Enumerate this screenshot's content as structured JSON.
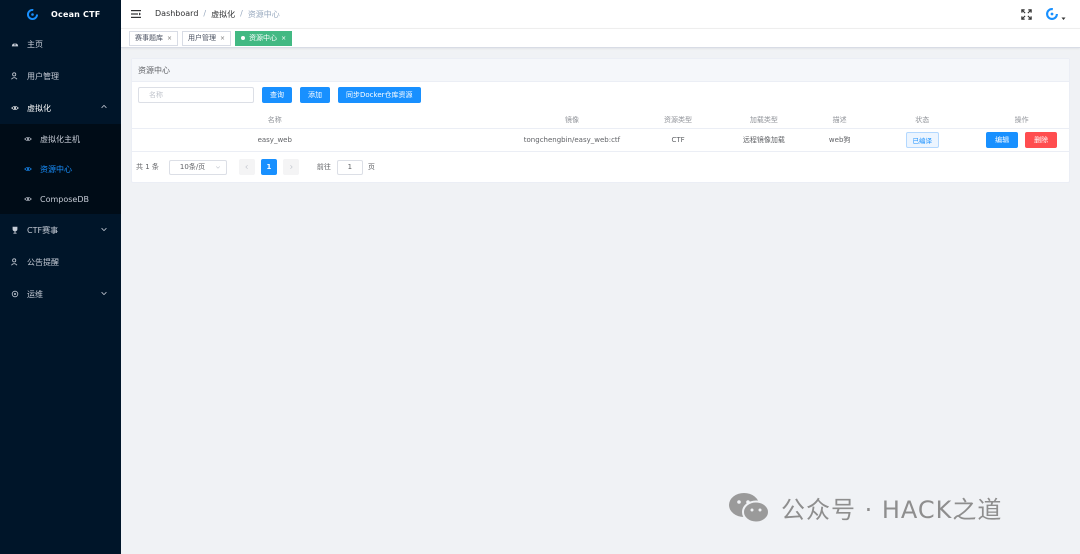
{
  "app": {
    "title": "Ocean CTF"
  },
  "sidebar": {
    "items": [
      {
        "label": "主页",
        "icon": "dashboard-icon"
      },
      {
        "label": "用户管理",
        "icon": "user-icon"
      },
      {
        "label": "虚拟化",
        "icon": "eye-icon",
        "expanded": true,
        "children": [
          {
            "label": "虚拟化主机",
            "icon": "eye-icon"
          },
          {
            "label": "资源中心",
            "icon": "eye-icon",
            "active": true
          },
          {
            "label": "ComposeDB",
            "icon": "eye-icon"
          }
        ]
      },
      {
        "label": "CTF赛事",
        "icon": "trophy-icon"
      },
      {
        "label": "公告提醒",
        "icon": "user-icon"
      },
      {
        "label": "运维",
        "icon": "settings-icon"
      }
    ]
  },
  "breadcrumb": {
    "items": [
      "Dashboard",
      "虚拟化",
      "资源中心"
    ]
  },
  "tags": [
    {
      "label": "赛事题库",
      "active": false
    },
    {
      "label": "用户管理",
      "active": false
    },
    {
      "label": "资源中心",
      "active": true
    }
  ],
  "card": {
    "title": "资源中心"
  },
  "search": {
    "placeholder": "名称",
    "query_label": "查询",
    "add_label": "添加",
    "sync_label": "同步Docker仓库资源"
  },
  "table": {
    "columns": [
      "名称",
      "镜像",
      "资源类型",
      "加载类型",
      "描述",
      "状态",
      "操作"
    ],
    "rows": [
      {
        "name": "easy_web",
        "image": "tongchengbin/easy_web:ctf",
        "resource_type": "CTF",
        "load_type": "远程镜像加载",
        "description": "web狗",
        "status": "已编译",
        "edit_label": "编辑",
        "delete_label": "删除"
      }
    ]
  },
  "pagination": {
    "total_text": "共 1 条",
    "page_size": "10条/页",
    "current_page": "1",
    "goto_label": "前往",
    "goto_value": "1",
    "page_unit": "页"
  },
  "watermark": {
    "text": "公众号 · HACK之道"
  },
  "colors": {
    "sidebar_bg": "#001529",
    "primary": "#1890ff",
    "danger": "#ff4d4f",
    "tag_active": "#42b983"
  }
}
